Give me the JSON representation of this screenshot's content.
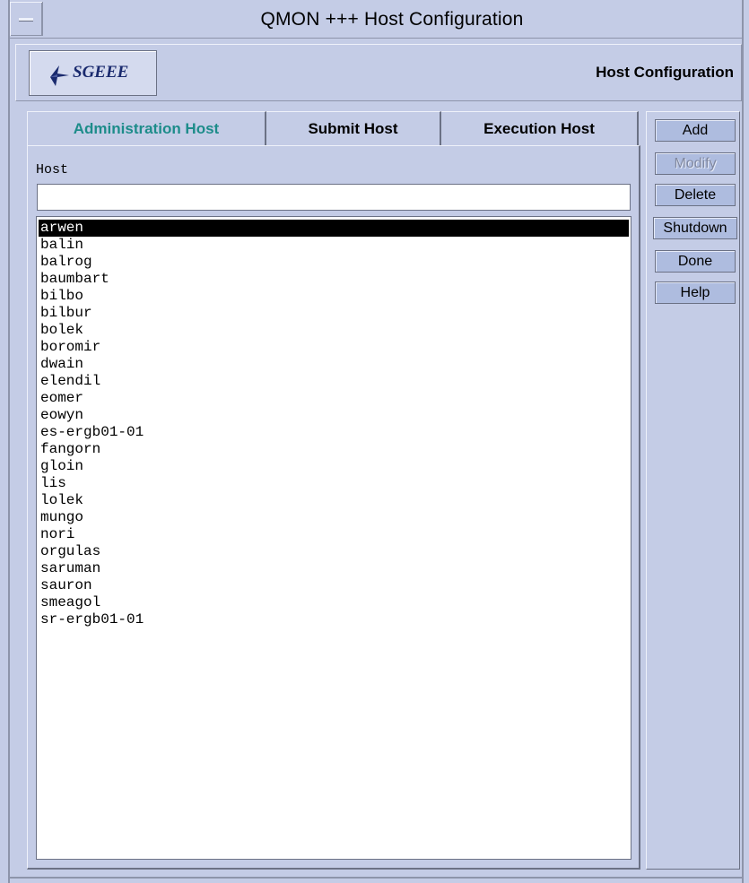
{
  "window": {
    "title": "QMON +++ Host Configuration"
  },
  "header": {
    "logo_text": "SGEEE",
    "title": "Host Configuration"
  },
  "tabs": [
    {
      "label": "Administration Host",
      "active": true
    },
    {
      "label": "Submit Host",
      "active": false
    },
    {
      "label": "Execution Host",
      "active": false
    }
  ],
  "host_field": {
    "label": "Host",
    "value": ""
  },
  "host_list": {
    "selected": "arwen",
    "items": [
      "arwen",
      "balin",
      "balrog",
      "baumbart",
      "bilbo",
      "bilbur",
      "bolek",
      "boromir",
      "dwain",
      "elendil",
      "eomer",
      "eowyn",
      "es-ergb01-01",
      "fangorn",
      "gloin",
      "lis",
      "lolek",
      "mungo",
      "nori",
      "orgulas",
      "saruman",
      "sauron",
      "smeagol",
      "sr-ergb01-01"
    ]
  },
  "buttons": {
    "add": "Add",
    "modify": "Modify",
    "delete": "Delete",
    "shutdown": "Shutdown",
    "done": "Done",
    "help": "Help"
  },
  "colors": {
    "background": "#c4cce6",
    "active_tab_text": "#1d8c8a",
    "button": "#aebcdf",
    "selection": "#000000"
  }
}
